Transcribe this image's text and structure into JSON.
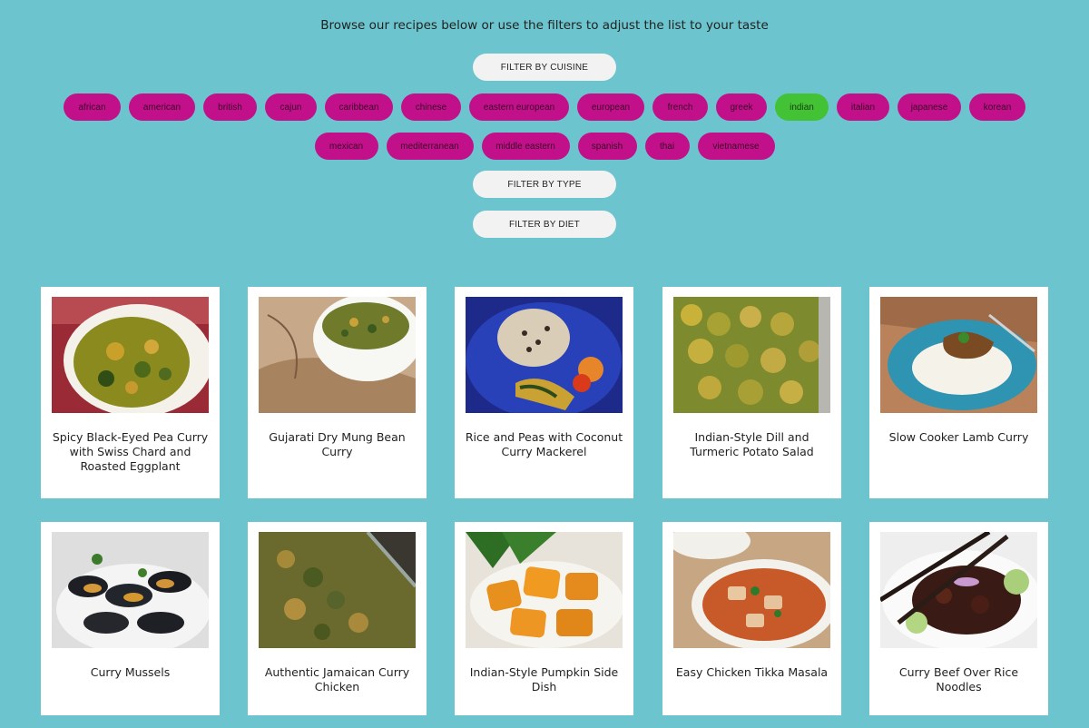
{
  "intro": "Browse our recipes below or use the filters to adjust the list to your taste",
  "filters": {
    "cuisine_label": "FILTER BY CUISINE",
    "type_label": "FILTER BY TYPE",
    "diet_label": "FILTER BY DIET"
  },
  "cuisines_row1": [
    "african",
    "american",
    "british",
    "cajun",
    "caribbean",
    "chinese",
    "eastern european",
    "european",
    "french",
    "greek",
    "indian",
    "italian",
    "japanese",
    "korean"
  ],
  "cuisines_row2": [
    "mexican",
    "mediterranean",
    "middle eastern",
    "spanish",
    "thai",
    "vietnamese"
  ],
  "selected_cuisine": "indian",
  "colors": {
    "background": "#6cc5ce",
    "chip": "#c2108a",
    "chip_active": "#44c236",
    "card": "#ffffff"
  },
  "recipes": [
    {
      "title": "Spicy Black-Eyed Pea Curry with Swiss Chard and Roasted Eggplant"
    },
    {
      "title": "Gujarati Dry Mung Bean Curry"
    },
    {
      "title": "Rice and Peas with Coconut Curry Mackerel"
    },
    {
      "title": "Indian-Style Dill and Turmeric Potato Salad"
    },
    {
      "title": "Slow Cooker Lamb Curry"
    },
    {
      "title": "Curry Mussels"
    },
    {
      "title": "Authentic Jamaican Curry Chicken"
    },
    {
      "title": "Indian-Style Pumpkin Side Dish"
    },
    {
      "title": "Easy Chicken Tikka Masala"
    },
    {
      "title": "Curry Beef Over Rice Noodles"
    }
  ]
}
